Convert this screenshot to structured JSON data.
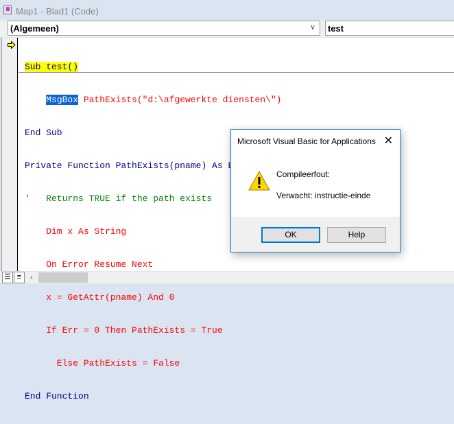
{
  "window": {
    "title": "Map1 - Blad1 (Code)"
  },
  "toolbar": {
    "object_combo": "(Algemeen)",
    "procedure_combo": "test"
  },
  "code": {
    "l1": "Sub test()",
    "l2_sel": "MsgBox",
    "l2_rest": " PathExists(\"d:\\afgewerkte diensten\\\")",
    "l3": "End Sub",
    "l4": "Private Function PathExists(pname) As Boolean",
    "l5": "'   Returns TRUE if the path exists",
    "l6": "    Dim x As String",
    "l7": "    On Error Resume Next",
    "l8": "    x = GetAttr(pname) And 0",
    "l9": "    If Err = 0 Then PathExists = True",
    "l10": "      Else PathExists = False",
    "l11": "End Function"
  },
  "dialog": {
    "title": "Microsoft Visual Basic for Applications",
    "close": "✕",
    "message": "Compileerfout:",
    "detail": "Verwacht: instructie-einde",
    "ok": "OK",
    "help": "Help"
  },
  "colors": {
    "keyword": "#00008b",
    "error": "#ff0000",
    "comment": "#008000",
    "highlight": "#ffff00",
    "selection": "#0a64d2"
  }
}
